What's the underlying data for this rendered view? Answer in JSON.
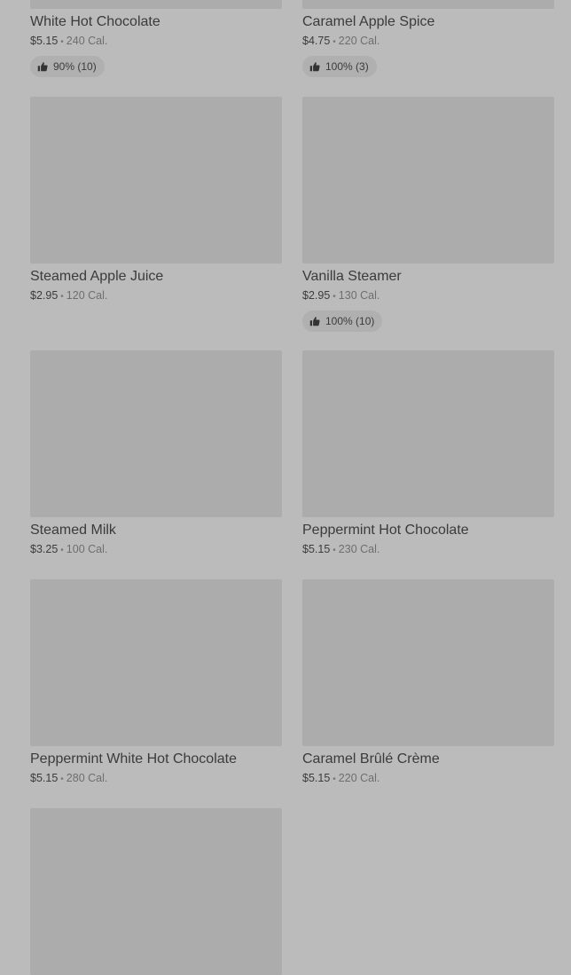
{
  "items": [
    {
      "name": "White Hot Chocolate",
      "price": "$5.15",
      "calories": "240 Cal.",
      "rating": "90% (10)"
    },
    {
      "name": "Caramel Apple Spice",
      "price": "$4.75",
      "calories": "220 Cal.",
      "rating": "100% (3)"
    },
    {
      "name": "Steamed Apple Juice",
      "price": "$2.95",
      "calories": "120 Cal.",
      "rating": ""
    },
    {
      "name": "Vanilla Steamer",
      "price": "$2.95",
      "calories": "130 Cal.",
      "rating": "100% (10)"
    },
    {
      "name": "Steamed Milk",
      "price": "$3.25",
      "calories": "100 Cal.",
      "rating": ""
    },
    {
      "name": "Peppermint Hot Chocolate",
      "price": "$5.15",
      "calories": "230 Cal.",
      "rating": ""
    },
    {
      "name": "Peppermint White Hot Chocolate",
      "price": "$5.15",
      "calories": "280 Cal.",
      "rating": ""
    },
    {
      "name": "Caramel Brûlé Crème",
      "price": "$5.15",
      "calories": "220 Cal.",
      "rating": ""
    }
  ],
  "separator": "•",
  "rating_icon": "thumbs-up-icon",
  "colors": {
    "background": "#bbbbbb",
    "placeholder": "#acacac",
    "badge": "#b0b0b0"
  }
}
